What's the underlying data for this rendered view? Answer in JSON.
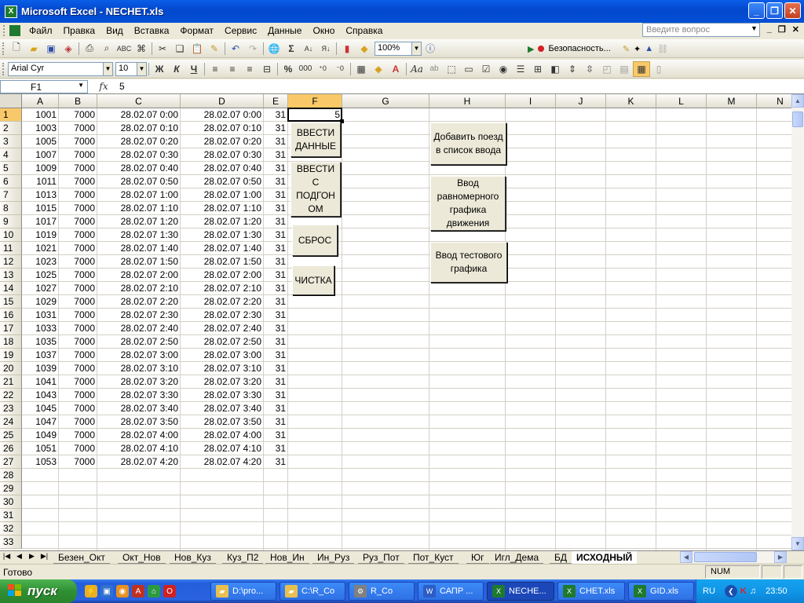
{
  "window": {
    "title": "Microsoft Excel - NECHET.xls"
  },
  "menu": [
    "Файл",
    "Правка",
    "Вид",
    "Вставка",
    "Формат",
    "Сервис",
    "Данные",
    "Окно",
    "Справка"
  ],
  "ask_placeholder": "Введите вопрос",
  "toolbar": {
    "zoom": "100%",
    "security_label": "Безопасность...",
    "font_name": "Arial Cyr",
    "font_size": "10",
    "bold": "Ж",
    "italic": "К",
    "underline": "Ч",
    "percent": "%",
    "thousands": "000",
    "fx": "fx"
  },
  "formula_bar": {
    "name_box": "F1",
    "value": "5"
  },
  "columns": [
    "A",
    "B",
    "C",
    "D",
    "E",
    "F",
    "G",
    "H",
    "I",
    "J",
    "K",
    "L",
    "M",
    "N"
  ],
  "rows": [
    [
      "1001",
      "7000",
      "28.02.07 0:00",
      "28.02.07 0:00",
      "31",
      "5"
    ],
    [
      "1003",
      "7000",
      "28.02.07 0:10",
      "28.02.07 0:10",
      "31",
      ""
    ],
    [
      "1005",
      "7000",
      "28.02.07 0:20",
      "28.02.07 0:20",
      "31",
      ""
    ],
    [
      "1007",
      "7000",
      "28.02.07 0:30",
      "28.02.07 0:30",
      "31",
      ""
    ],
    [
      "1009",
      "7000",
      "28.02.07 0:40",
      "28.02.07 0:40",
      "31",
      ""
    ],
    [
      "1011",
      "7000",
      "28.02.07 0:50",
      "28.02.07 0:50",
      "31",
      ""
    ],
    [
      "1013",
      "7000",
      "28.02.07 1:00",
      "28.02.07 1:00",
      "31",
      ""
    ],
    [
      "1015",
      "7000",
      "28.02.07 1:10",
      "28.02.07 1:10",
      "31",
      ""
    ],
    [
      "1017",
      "7000",
      "28.02.07 1:20",
      "28.02.07 1:20",
      "31",
      ""
    ],
    [
      "1019",
      "7000",
      "28.02.07 1:30",
      "28.02.07 1:30",
      "31",
      ""
    ],
    [
      "1021",
      "7000",
      "28.02.07 1:40",
      "28.02.07 1:40",
      "31",
      ""
    ],
    [
      "1023",
      "7000",
      "28.02.07 1:50",
      "28.02.07 1:50",
      "31",
      ""
    ],
    [
      "1025",
      "7000",
      "28.02.07 2:00",
      "28.02.07 2:00",
      "31",
      ""
    ],
    [
      "1027",
      "7000",
      "28.02.07 2:10",
      "28.02.07 2:10",
      "31",
      ""
    ],
    [
      "1029",
      "7000",
      "28.02.07 2:20",
      "28.02.07 2:20",
      "31",
      ""
    ],
    [
      "1031",
      "7000",
      "28.02.07 2:30",
      "28.02.07 2:30",
      "31",
      ""
    ],
    [
      "1033",
      "7000",
      "28.02.07 2:40",
      "28.02.07 2:40",
      "31",
      ""
    ],
    [
      "1035",
      "7000",
      "28.02.07 2:50",
      "28.02.07 2:50",
      "31",
      ""
    ],
    [
      "1037",
      "7000",
      "28.02.07 3:00",
      "28.02.07 3:00",
      "31",
      ""
    ],
    [
      "1039",
      "7000",
      "28.02.07 3:10",
      "28.02.07 3:10",
      "31",
      ""
    ],
    [
      "1041",
      "7000",
      "28.02.07 3:20",
      "28.02.07 3:20",
      "31",
      ""
    ],
    [
      "1043",
      "7000",
      "28.02.07 3:30",
      "28.02.07 3:30",
      "31",
      ""
    ],
    [
      "1045",
      "7000",
      "28.02.07 3:40",
      "28.02.07 3:40",
      "31",
      ""
    ],
    [
      "1047",
      "7000",
      "28.02.07 3:50",
      "28.02.07 3:50",
      "31",
      ""
    ],
    [
      "1049",
      "7000",
      "28.02.07 4:00",
      "28.02.07 4:00",
      "31",
      ""
    ],
    [
      "1051",
      "7000",
      "28.02.07 4:10",
      "28.02.07 4:10",
      "31",
      ""
    ],
    [
      "1053",
      "7000",
      "28.02.07 4:20",
      "28.02.07 4:20",
      "31",
      ""
    ],
    [
      "",
      "",
      "",
      "",
      "",
      ""
    ],
    [
      "",
      "",
      "",
      "",
      "",
      ""
    ],
    [
      "",
      "",
      "",
      "",
      "",
      ""
    ],
    [
      "",
      "",
      "",
      "",
      "",
      ""
    ],
    [
      "",
      "",
      "",
      "",
      "",
      ""
    ],
    [
      "",
      "",
      "",
      "",
      "",
      ""
    ]
  ],
  "row_numbers": [
    "1",
    "2",
    "3",
    "4",
    "5",
    "6",
    "7",
    "8",
    "9",
    "10",
    "11",
    "12",
    "13",
    "14",
    "15",
    "16",
    "17",
    "18",
    "19",
    "20",
    "21",
    "22",
    "23",
    "24",
    "25",
    "26",
    "27",
    "28",
    "29",
    "30",
    "31",
    "32",
    "33"
  ],
  "buttons": {
    "vvesti_dannye": "ВВЕСТИ ДАННЫЕ",
    "vvesti_s_podgonom": "ВВЕСТИ С ПОДГОН ОМ",
    "sbros": "СБРОС",
    "chistka": "ЧИСТКА",
    "add_train": "Добавить поезд в список ввода",
    "uniform_schedule": "Ввод равномерного графика движения",
    "test_schedule": "Ввод тестового графика"
  },
  "sheet_tabs": [
    "Безен_Окт",
    "Окт_Нов",
    "Нов_Куз",
    "Куз_П2",
    "Нов_Ин",
    "Ин_Руз",
    "Руз_Пот",
    "Пот_Куст",
    "Юг",
    "Игл_Дема",
    "БД",
    "ИСХОДНЫЙ"
  ],
  "active_tab": "ИСХОДНЫЙ",
  "status": {
    "text": "Готово",
    "num": "NUM"
  },
  "taskbar": {
    "start": "пуск",
    "items": [
      "D:\\pro...",
      "C:\\R_Co",
      "R_Co",
      "САПР ...",
      "NECHE...",
      "CHET.xls",
      "GID.xls"
    ],
    "lang": "RU",
    "time": "23:50"
  }
}
